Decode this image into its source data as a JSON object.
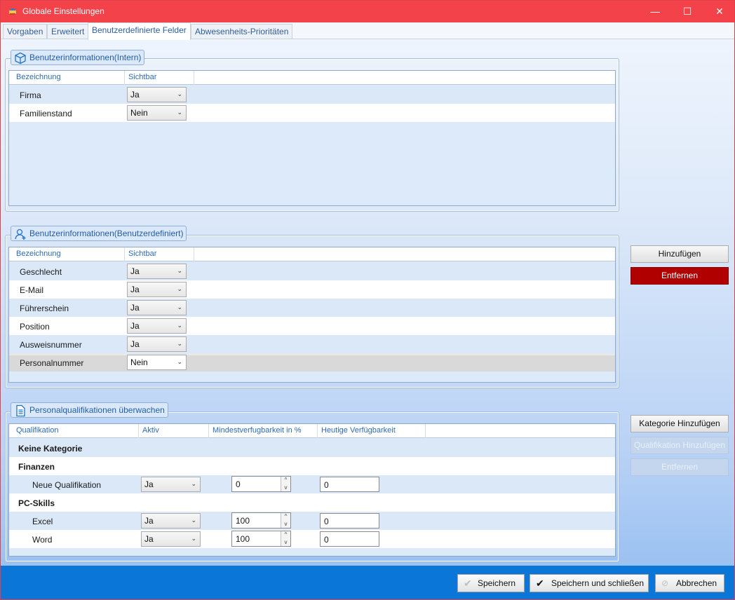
{
  "window": {
    "title": "Globale Einstellungen",
    "minimize": "—",
    "maximize": "☐",
    "close": "✕"
  },
  "tabs": [
    "Vorgaben",
    "Erweitert",
    "Benutzerdefinierte Felder",
    "Abwesenheits-Prioritäten"
  ],
  "active_tab": "Benutzerdefinierte Felder",
  "group_intern": {
    "title": "Benutzerinformationen(Intern)",
    "headers": [
      "Bezeichnung",
      "Sichtbar"
    ],
    "rows": [
      {
        "label": "Firma",
        "visible": "Ja"
      },
      {
        "label": "Familienstand",
        "visible": "Nein"
      }
    ]
  },
  "group_custom": {
    "title": "Benutzerinformationen(Benutzerdefiniert)",
    "headers": [
      "Bezeichnung",
      "Sichtbar"
    ],
    "rows": [
      {
        "label": "Geschlecht",
        "visible": "Ja"
      },
      {
        "label": "E-Mail",
        "visible": "Ja"
      },
      {
        "label": "Führerschein",
        "visible": "Ja"
      },
      {
        "label": "Position",
        "visible": "Ja"
      },
      {
        "label": "Ausweisnummer",
        "visible": "Ja"
      },
      {
        "label": "Personalnummer",
        "visible": "Nein"
      }
    ],
    "add_button": "Hinzufügen",
    "remove_button": "Entfernen"
  },
  "group_qual": {
    "title": "Personalqualifikationen überwachen",
    "headers": [
      "Qualifikation",
      "Aktiv",
      "Mindestverfugbarkeit in %",
      "Heutige Verfügbarkeit"
    ],
    "categories": [
      "Keine Kategorie",
      "Finanzen",
      "PC-Skills"
    ],
    "items": [
      {
        "name": "Neue Qualifikation",
        "active": "Ja",
        "min": "0",
        "today": "0"
      },
      {
        "name": "Excel",
        "active": "Ja",
        "min": "100",
        "today": "0"
      },
      {
        "name": "Word",
        "active": "Ja",
        "min": "100",
        "today": "0"
      }
    ],
    "add_category_button": "Kategorie Hinzufügen",
    "add_qualification_button": "Qualifikation Hinzufügen",
    "remove_button": "Entfernen"
  },
  "footer": {
    "save": "Speichern",
    "save_close": "Speichern und schließen",
    "cancel": "Abbrechen"
  },
  "colors": {
    "titlebar": "#f4424a",
    "footer": "#0a76d8",
    "danger": "#b10000",
    "header_text": "#2d6bb4"
  }
}
